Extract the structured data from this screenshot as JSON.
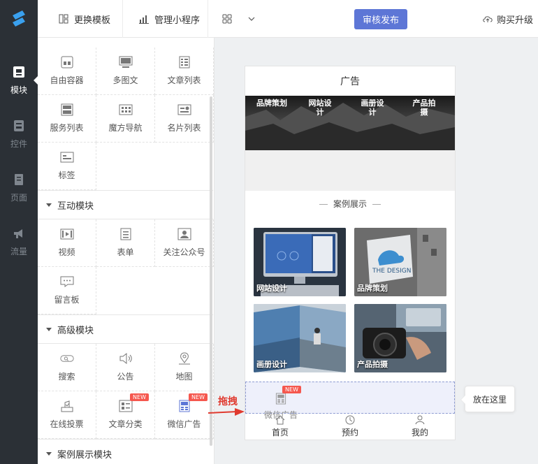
{
  "rail": {
    "items": [
      {
        "label": "模块",
        "icon": "module-icon",
        "active": true
      },
      {
        "label": "控件",
        "icon": "widget-icon",
        "active": false
      },
      {
        "label": "页面",
        "icon": "page-icon",
        "active": false
      },
      {
        "label": "流量",
        "icon": "megaphone-icon",
        "active": false
      }
    ]
  },
  "toolbar": {
    "change_template": "更换模板",
    "manage_miniprogram": "管理小程序",
    "publish": "审核发布",
    "upgrade": "购买升级"
  },
  "panel": {
    "base_items": [
      {
        "label": "自由容器",
        "icon": "container-icon"
      },
      {
        "label": "多图文",
        "icon": "multi-image-icon"
      },
      {
        "label": "文章列表",
        "icon": "article-list-icon"
      },
      {
        "label": "服务列表",
        "icon": "service-list-icon"
      },
      {
        "label": "魔方导航",
        "icon": "grid-nav-icon"
      },
      {
        "label": "名片列表",
        "icon": "card-list-icon"
      },
      {
        "label": "标签",
        "icon": "tag-icon"
      }
    ],
    "interactive_title": "互动模块",
    "interactive_items": [
      {
        "label": "视频",
        "icon": "video-icon"
      },
      {
        "label": "表单",
        "icon": "form-icon"
      },
      {
        "label": "关注公众号",
        "icon": "follow-icon"
      },
      {
        "label": "留言板",
        "icon": "message-board-icon"
      }
    ],
    "advanced_title": "高级模块",
    "advanced_items": [
      {
        "label": "搜索",
        "icon": "search-icon",
        "new": false
      },
      {
        "label": "公告",
        "icon": "speaker-icon",
        "new": false
      },
      {
        "label": "地图",
        "icon": "map-pin-icon",
        "new": false
      },
      {
        "label": "在线投票",
        "icon": "vote-icon",
        "new": false
      },
      {
        "label": "文章分类",
        "icon": "article-category-icon",
        "new": true
      },
      {
        "label": "微信广告",
        "icon": "wechat-ad-icon",
        "new": true
      }
    ],
    "case_title": "案例展示模块",
    "new_badge": "NEW"
  },
  "phone": {
    "title": "广告",
    "banner_tabs": [
      "品牌策划",
      "网站设计",
      "画册设计",
      "产品拍摄"
    ],
    "case_heading": "案例展示",
    "cases": [
      {
        "caption": "网站设计"
      },
      {
        "caption": "品牌策划"
      },
      {
        "caption": "画册设计"
      },
      {
        "caption": "产品拍摄"
      }
    ],
    "drag_ghost_label": "微信广告",
    "tabs": [
      {
        "label": "首页",
        "icon": "home-icon"
      },
      {
        "label": "预约",
        "icon": "clock-icon"
      },
      {
        "label": "我的",
        "icon": "user-icon"
      }
    ]
  },
  "hint": {
    "drag_label": "拖拽",
    "drop_tooltip": "放在这里"
  },
  "colors": {
    "accent": "#5d76d6",
    "rail": "#2b3036",
    "badge": "#f5574e",
    "drag_red": "#e03a2f"
  }
}
